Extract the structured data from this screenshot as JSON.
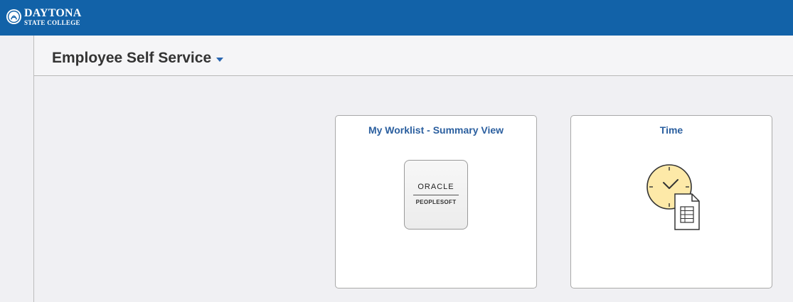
{
  "brand": {
    "line1": "DAYTONA",
    "line2": "STATE COLLEGE"
  },
  "header": {
    "title": "Employee Self Service"
  },
  "tiles": [
    {
      "title": "My Worklist - Summary View",
      "icon": "oracle-peoplesoft-logo",
      "logo_word": "ORACLE",
      "logo_sub": "PEOPLESOFT"
    },
    {
      "title": "Time",
      "icon": "clock-timesheet-icon"
    }
  ],
  "colors": {
    "topbar": "#1262a8",
    "tile_title": "#2b5f9f",
    "background": "#f0f0f3",
    "clock_face": "#fde9a8"
  }
}
